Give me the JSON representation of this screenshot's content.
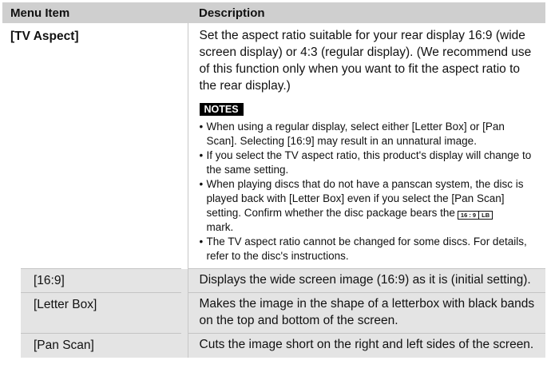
{
  "table": {
    "header": {
      "col1": "Menu Item",
      "col2": "Description"
    },
    "main_item": {
      "label": "[TV Aspect]",
      "description": "Set the aspect ratio suitable for your rear display 16:9 (wide screen display) or 4:3 (regular display). (We recommend use of this function only when you want to fit the aspect ratio to the rear display.)",
      "notes_label": "NOTES",
      "notes": [
        "When using a regular display, select either [Letter Box] or [Pan Scan]. Selecting [16:9] may result in an unnatural image.",
        "If you select the TV aspect ratio, this product's display will change to the same setting.",
        "The TV aspect ratio cannot be changed for some discs. For details, refer to the disc's instructions."
      ],
      "note_disc_text": "When playing discs that do not have a panscan system, the disc is played back with [Letter Box] even if you select the [Pan Scan] setting. Confirm whether the disc package bears the",
      "note_disc_suffix": "mark.",
      "mark": {
        "left": "16 : 9",
        "right": "LB"
      }
    },
    "sub_items": [
      {
        "label": "[16:9]",
        "description": "Displays the wide screen image (16:9) as it is (initial setting)."
      },
      {
        "label": "[Letter Box]",
        "description": "Makes the image in the shape of a letterbox with black bands on the top and bottom of the screen."
      },
      {
        "label": "[Pan Scan]",
        "description": "Cuts the image short on the right and left sides of the screen."
      }
    ]
  }
}
